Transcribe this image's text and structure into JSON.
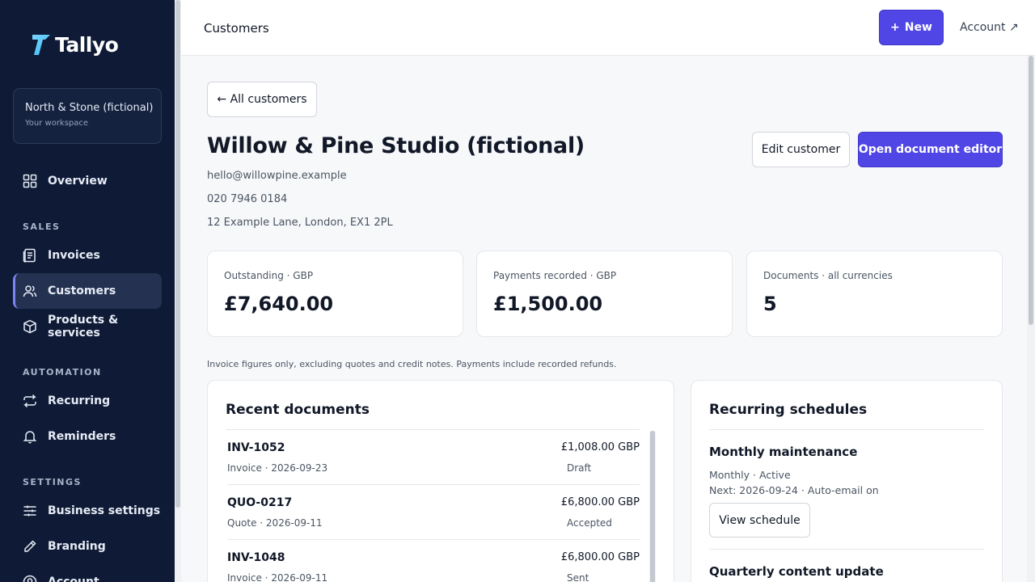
{
  "brand": {
    "name": "Tallyo",
    "accent": "#4f46e5",
    "sidebar_bg": "#0f1b36"
  },
  "workspace": {
    "name": "North & Stone (fictional)",
    "subtitle": "Your workspace"
  },
  "nav": {
    "overview": {
      "label": "Overview",
      "icon": "grid-icon"
    },
    "sales_heading": "SALES",
    "invoices": {
      "label": "Invoices",
      "icon": "document-icon"
    },
    "customers": {
      "label": "Customers",
      "icon": "users-icon"
    },
    "products": {
      "label": "Products & services",
      "icon": "box-icon"
    },
    "automation_heading": "AUTOMATION",
    "recurring": {
      "label": "Recurring",
      "icon": "repeat-icon"
    },
    "reminders": {
      "label": "Reminders",
      "icon": "bell-icon"
    },
    "settings_heading": "SETTINGS",
    "business": {
      "label": "Business settings",
      "icon": "sliders-icon"
    },
    "branding": {
      "label": "Branding",
      "icon": "pen-icon"
    },
    "account": {
      "label": "Account",
      "icon": "user-circle-icon"
    }
  },
  "topbar": {
    "title": "Customers",
    "new_label": "New",
    "account_label": "Account ↗"
  },
  "customer": {
    "back_label": "← All customers",
    "name": "Willow & Pine Studio (fictional)",
    "email": "hello@willowpine.example",
    "phone": "020 7946 0184",
    "address": "12 Example Lane, London, EX1 2PL",
    "edit_label": "Edit customer",
    "editor_label": "Open document editor"
  },
  "stats": [
    {
      "label": "Outstanding · GBP",
      "value": "£7,640.00"
    },
    {
      "label": "Payments recorded · GBP",
      "value": "£1,500.00"
    },
    {
      "label": "Documents · all currencies",
      "value": "5"
    }
  ],
  "note": "Invoice figures only, excluding quotes and credit notes. Payments include recorded refunds.",
  "recent": {
    "title": "Recent documents",
    "rows": [
      {
        "number": "INV-1052",
        "meta": "Invoice · 2026-09-23",
        "amount": "£1,008.00 GBP",
        "status": "Draft"
      },
      {
        "number": "QUO-0217",
        "meta": "Quote · 2026-09-11",
        "amount": "£6,800.00 GBP",
        "status": "Accepted"
      },
      {
        "number": "INV-1048",
        "meta": "Invoice · 2026-09-11",
        "amount": "£6,800.00 GBP",
        "status": "Sent"
      }
    ]
  },
  "recurring": {
    "title": "Recurring schedules",
    "items": [
      {
        "name": "Monthly maintenance",
        "freq": "Monthly · Active",
        "next": "Next: 2026-09-24 · Auto-email on",
        "button": "View schedule"
      },
      {
        "name": "Quarterly content update"
      }
    ]
  }
}
